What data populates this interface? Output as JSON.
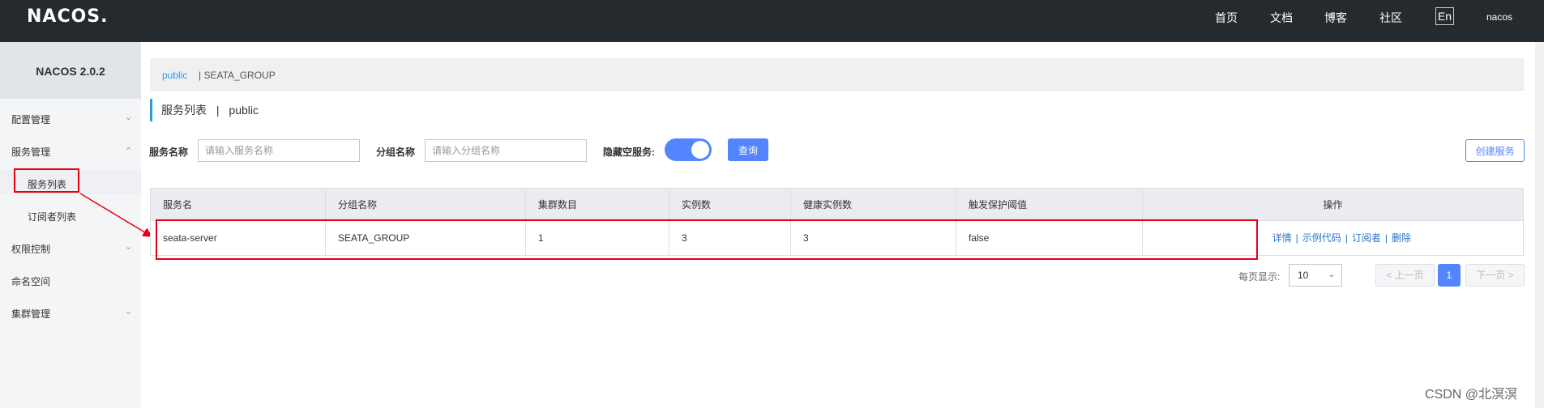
{
  "app": {
    "logo_text": "NACOS",
    "logo_dot": "."
  },
  "topnav": {
    "home": "首页",
    "docs": "文档",
    "blog": "博客",
    "community": "社区",
    "lang": "En",
    "user": "nacos"
  },
  "sidebar": {
    "title": "NACOS 2.0.2",
    "items": [
      {
        "label": "配置管理"
      },
      {
        "label": "服务管理"
      },
      {
        "label": "服务列表"
      },
      {
        "label": "订阅者列表"
      },
      {
        "label": "权限控制"
      },
      {
        "label": "命名空间"
      },
      {
        "label": "集群管理"
      }
    ]
  },
  "breadcrumb": {
    "namespace": "public",
    "group": "| SEATA_GROUP"
  },
  "page": {
    "title": "服务列表",
    "sep": "|",
    "namespace": "public"
  },
  "filters": {
    "service_label": "服务名称",
    "service_placeholder": "请输入服务名称",
    "group_label": "分组名称",
    "group_placeholder": "请输入分组名称",
    "hide_empty_label": "隐藏空服务:",
    "hide_empty_on": true,
    "query_button": "查询",
    "create_button": "创建服务"
  },
  "table": {
    "columns": [
      "服务名",
      "分组名称",
      "集群数目",
      "实例数",
      "健康实例数",
      "触发保护阈值",
      "操作"
    ],
    "rows": [
      {
        "name": "seata-server",
        "group": "SEATA_GROUP",
        "clusters": "1",
        "instances": "3",
        "healthy": "3",
        "threshold": "false",
        "actions": [
          "详情",
          "示例代码",
          "订阅者",
          "删除"
        ]
      }
    ]
  },
  "pager": {
    "per_page_label": "每页显示:",
    "per_page": "10",
    "prev": "< 上一页",
    "current": "1",
    "next": "下一页 >"
  },
  "watermark": "CSDN @北溟溟",
  "colors": {
    "accent": "#5584ff",
    "header_bg": "#252a2f",
    "annotation_red": "#e60012",
    "link": "#2d74c7"
  }
}
